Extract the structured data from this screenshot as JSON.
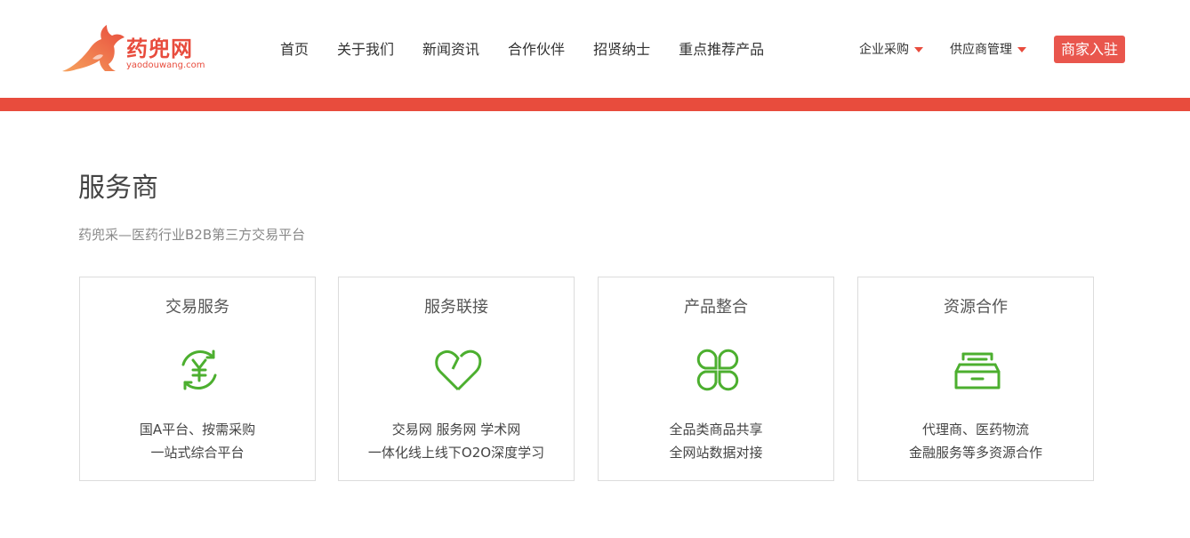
{
  "brand": {
    "name_cn": "药兜网",
    "name_en": "yaodouwang.com",
    "color": "#e84c3d"
  },
  "nav": {
    "items": [
      "首页",
      "关于我们",
      "新闻资讯",
      "合作伙伴",
      "招贤纳士",
      "重点推荐产品"
    ]
  },
  "header_right": {
    "procurement_label": "企业采购",
    "supplier_label": "供应商管理",
    "join_label": "商家入驻"
  },
  "main": {
    "title": "服务商",
    "subtitle": "药兜采—医药行业B2B第三方交易平台",
    "cards": [
      {
        "title": "交易服务",
        "icon": "yuan-cycle-icon",
        "line1": "国A平台、按需采购",
        "line2": "一站式综合平台"
      },
      {
        "title": "服务联接",
        "icon": "heart-icon",
        "line1": "交易网 服务网 学术网",
        "line2": "一体化线上线下O2O深度学习"
      },
      {
        "title": "产品整合",
        "icon": "clover-icon",
        "line1": "全品类商品共享",
        "line2": "全网站数据对接"
      },
      {
        "title": "资源合作",
        "icon": "archive-box-icon",
        "line1": "代理商、医药物流",
        "line2": "金融服务等多资源合作"
      }
    ]
  },
  "colors": {
    "accent_red": "#e84c3d",
    "icon_green": "#4caf2f"
  }
}
